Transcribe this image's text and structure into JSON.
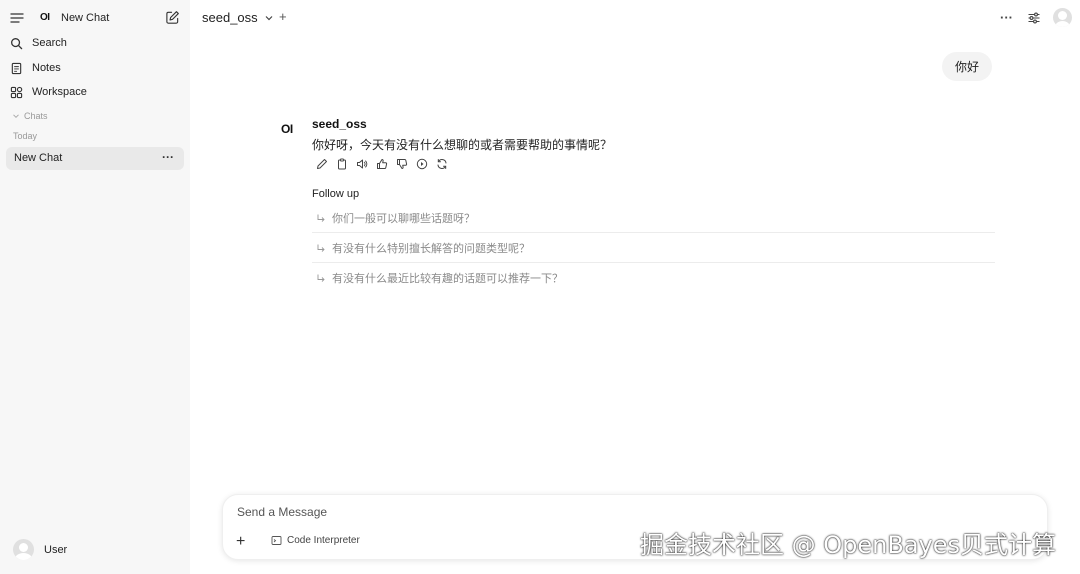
{
  "sidebar": {
    "logo": "OI",
    "new_chat_label": "New Chat",
    "nav": [
      {
        "label": "Search",
        "icon": "search-icon"
      },
      {
        "label": "Notes",
        "icon": "notes-icon"
      },
      {
        "label": "Workspace",
        "icon": "workspace-icon"
      }
    ],
    "chats_header": "Chats",
    "today_label": "Today",
    "chat_items": [
      {
        "label": "New Chat"
      }
    ],
    "user_name": "User"
  },
  "header": {
    "model_name": "seed_oss",
    "add_model_symbol": "+",
    "more_symbol": "···"
  },
  "messages": {
    "user_message": "你好",
    "assistant_logo": "OI",
    "assistant_name": "seed_oss",
    "assistant_text": "你好呀，今天有没有什么想聊的或者需要帮助的事情呢？",
    "actions": [
      "edit-icon",
      "copy-icon",
      "read-aloud-icon",
      "thumbs-up-icon",
      "thumbs-down-icon",
      "continue-icon",
      "regenerate-icon"
    ],
    "follow_up_title": "Follow up",
    "follow_ups": [
      "你们一般可以聊哪些话题呀？",
      "有没有什么特别擅长解答的问题类型呢？",
      "有没有什么最近比较有趣的话题可以推荐一下？"
    ]
  },
  "composer": {
    "placeholder": "Send a Message",
    "plus_symbol": "+",
    "code_interpreter_label": "Code Interpreter"
  },
  "watermark": "掘金技术社区 @ OpenBayes贝式计算",
  "colors": {
    "sidebar_bg": "#f7f7f7",
    "active_chat_bg": "#e9e9e9",
    "user_bubble_bg": "#f3f3f3",
    "followup_text": "#8a8a8a"
  }
}
